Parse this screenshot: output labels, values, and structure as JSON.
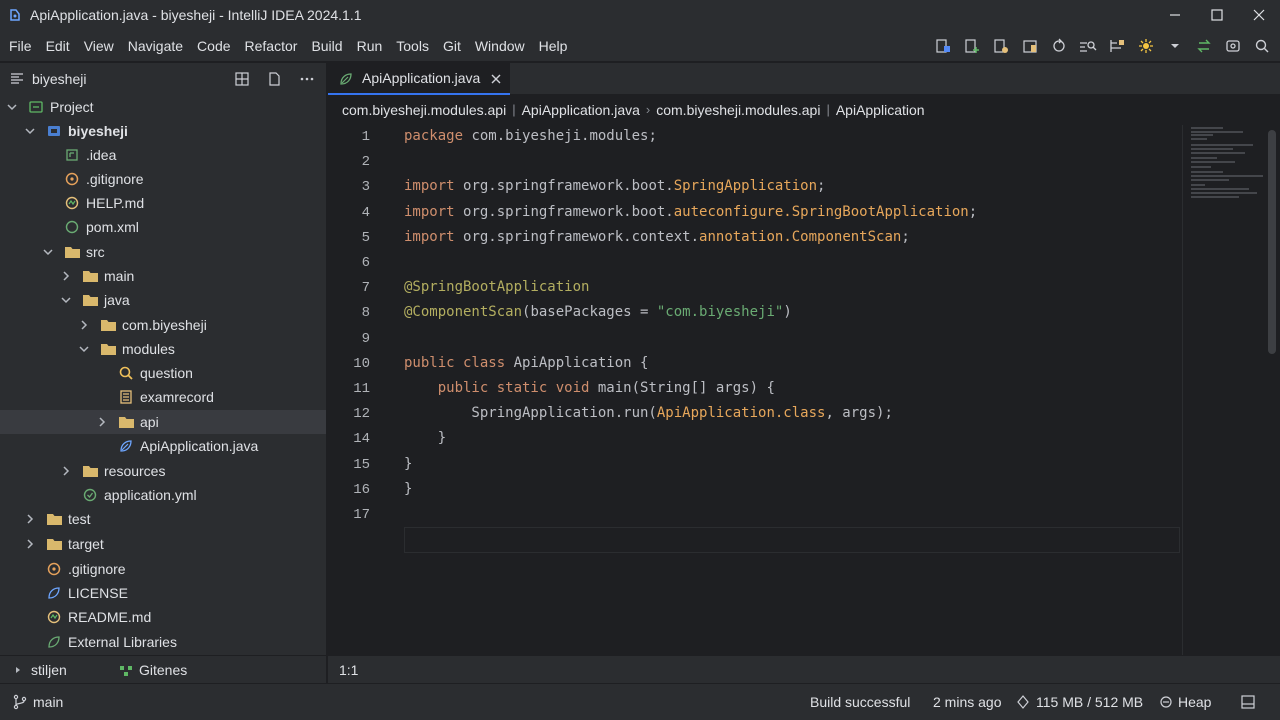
{
  "window": {
    "title": "ApiApplication.java - biyesheji - IntelliJ IDEA 2024.1.1"
  },
  "menu": [
    "File",
    "Edit",
    "View",
    "Navigate",
    "Code",
    "Refactor",
    "Build",
    "Run",
    "Tools",
    "Git",
    "Window",
    "Help"
  ],
  "toolbar_icons": [
    "build-icon",
    "add-config-icon",
    "run-config-icon",
    "bookmark-icon",
    "sync-icon",
    "coverage-icon",
    "structure-icon",
    "ai-assistant-icon",
    "dropdown-icon",
    "vcs-update-icon",
    "vcs-commit-icon",
    "search-everywhere-icon"
  ],
  "sidebar": {
    "project_name": "biyesheji",
    "tree": [
      {
        "label": "Project",
        "icon": "project-icon",
        "expanded": true,
        "bold": false
      },
      {
        "label": "biyesheji",
        "icon": "module-icon",
        "expanded": true,
        "bold": true
      },
      {
        "label": ".idea",
        "icon": "idea-folder-icon"
      },
      {
        "label": ".gitignore",
        "icon": "gitignore-icon"
      },
      {
        "label": "HELP.md",
        "icon": "markdown-icon"
      },
      {
        "label": "pom.xml",
        "icon": "maven-icon"
      },
      {
        "label": "src",
        "icon": "folder-icon",
        "expanded": true
      },
      {
        "label": "main",
        "icon": "folder-icon",
        "expanded": false
      },
      {
        "label": "java",
        "icon": "folder-icon",
        "expanded": true
      },
      {
        "label": "com.biyesheji",
        "icon": "folder-icon",
        "expanded": false
      },
      {
        "label": "modules",
        "icon": "folder-icon",
        "expanded": true
      },
      {
        "label": "question",
        "icon": "search-class-icon"
      },
      {
        "label": "examrecord",
        "icon": "file-list-icon"
      },
      {
        "label": "api",
        "icon": "folder-icon",
        "expanded": false,
        "selected": true
      },
      {
        "label": "ApiApplication.java",
        "icon": "spring-boot-icon"
      },
      {
        "label": "resources",
        "icon": "folder-icon",
        "expanded": false
      },
      {
        "label": "application.yml",
        "icon": "spring-config-icon"
      },
      {
        "label": "test",
        "icon": "folder-icon",
        "expanded": false
      },
      {
        "label": "target",
        "icon": "folder-icon",
        "expanded": false
      },
      {
        "label": ".gitignore",
        "icon": "gitignore-icon"
      },
      {
        "label": "LICENSE",
        "icon": "license-icon"
      },
      {
        "label": "README.md",
        "icon": "markdown-icon"
      },
      {
        "label": "External Libraries",
        "icon": "libraries-icon"
      }
    ]
  },
  "editor": {
    "tab_label": "ApiApplication.java",
    "breadcrumb": [
      "com.biyesheji.modules.api",
      "ApiApplication.java",
      "com.biyesheji.modules.api",
      "ApiApplication"
    ],
    "line_numbers": [
      "1",
      "2",
      "3",
      "4",
      "5",
      "6",
      "7",
      "8",
      "9",
      "10",
      "11",
      "12",
      "14",
      "15",
      "16",
      "17"
    ],
    "code": [
      [
        [
          "kw",
          "package "
        ],
        [
          "plain",
          "com.biyesheji.modules;"
        ]
      ],
      [],
      [
        [
          "kw",
          "import "
        ],
        [
          "plain",
          "org.springframework.boot."
        ],
        [
          "cls",
          "SpringApplication"
        ],
        [
          "plain",
          ";"
        ]
      ],
      [
        [
          "kw",
          "import "
        ],
        [
          "plain",
          "org.springframework.boot."
        ],
        [
          "cls",
          "auteconfigure.SpringBootApplication"
        ],
        [
          "plain",
          ";"
        ]
      ],
      [
        [
          "kw",
          "import "
        ],
        [
          "plain",
          "org.springframework.context."
        ],
        [
          "cls",
          "annotation.ComponentScan"
        ],
        [
          "plain",
          ";"
        ]
      ],
      [],
      [
        [
          "an",
          "@SpringBootApplication"
        ]
      ],
      [
        [
          "an",
          "@ComponentScan"
        ],
        [
          "plain",
          "(basePackages = "
        ],
        [
          "str",
          "\"com.biyesheji\""
        ],
        [
          "plain",
          ")"
        ]
      ],
      [],
      [
        [
          "kw",
          "public class "
        ],
        [
          "plain",
          "ApiApplication {"
        ]
      ],
      [
        [
          "plain",
          "    "
        ],
        [
          "kw",
          "public static void "
        ],
        [
          "plain",
          "main(String[] args) {"
        ]
      ],
      [
        [
          "plain",
          "        SpringApplication.run("
        ],
        [
          "cls",
          "ApiApplication.class"
        ],
        [
          "plain",
          ", args);"
        ]
      ],
      [
        [
          "plain",
          "    }"
        ]
      ],
      [
        [
          "plain",
          "}"
        ]
      ],
      [
        [
          "plain",
          "}"
        ]
      ],
      []
    ]
  },
  "bottom": {
    "left_tab1": "stiljen",
    "left_tab2": "Gitenes",
    "caret_position": "1:1"
  },
  "status": {
    "branch": "main",
    "build": "Build successful",
    "time": "2 mins ago",
    "memory": "115 MB / 512 MB",
    "heap": "Heap"
  },
  "colors": {
    "accent": "#3574f0",
    "keyword": "#cf8e6d",
    "string": "#6aab73",
    "annotation": "#b3ae60",
    "class": "#e7a75b"
  }
}
